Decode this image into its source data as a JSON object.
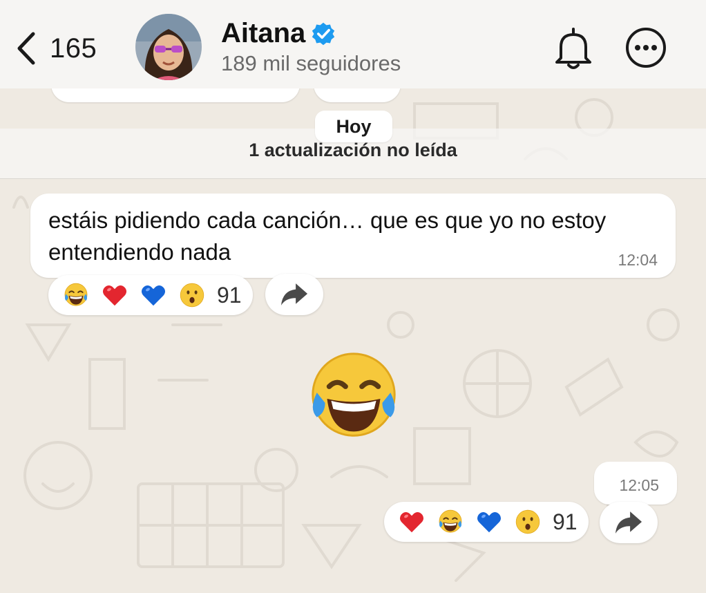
{
  "header": {
    "back_count": "165",
    "contact_name": "Aitana",
    "followers": "189 mil seguidores",
    "icons": {
      "back": "chevron-left-icon",
      "verified": "verified-badge-icon",
      "notifications": "bell-icon",
      "more": "more-options-icon"
    }
  },
  "chat": {
    "date_label": "Hoy",
    "unread_label": "1 actualización no leída",
    "messages": [
      {
        "text": "estáis pidiendo cada canción… que es que yo no estoy entendiendo nada",
        "time": "12:04",
        "reactions": {
          "emojis": [
            "laughing-tears",
            "red-heart",
            "blue-heart",
            "surprised-face"
          ],
          "count": "91"
        }
      },
      {
        "emoji": "laughing-tears",
        "time": "12:05",
        "reactions": {
          "emojis": [
            "red-heart",
            "laughing-tears",
            "blue-heart",
            "surprised-face"
          ],
          "count": "91"
        }
      }
    ]
  },
  "colors": {
    "wallpaper": "#efeae2",
    "header": "#f6f5f3",
    "bubble": "#ffffff",
    "verified": "#1d9bf0",
    "heart_red": "#e3262f",
    "heart_blue": "#1565d8"
  }
}
